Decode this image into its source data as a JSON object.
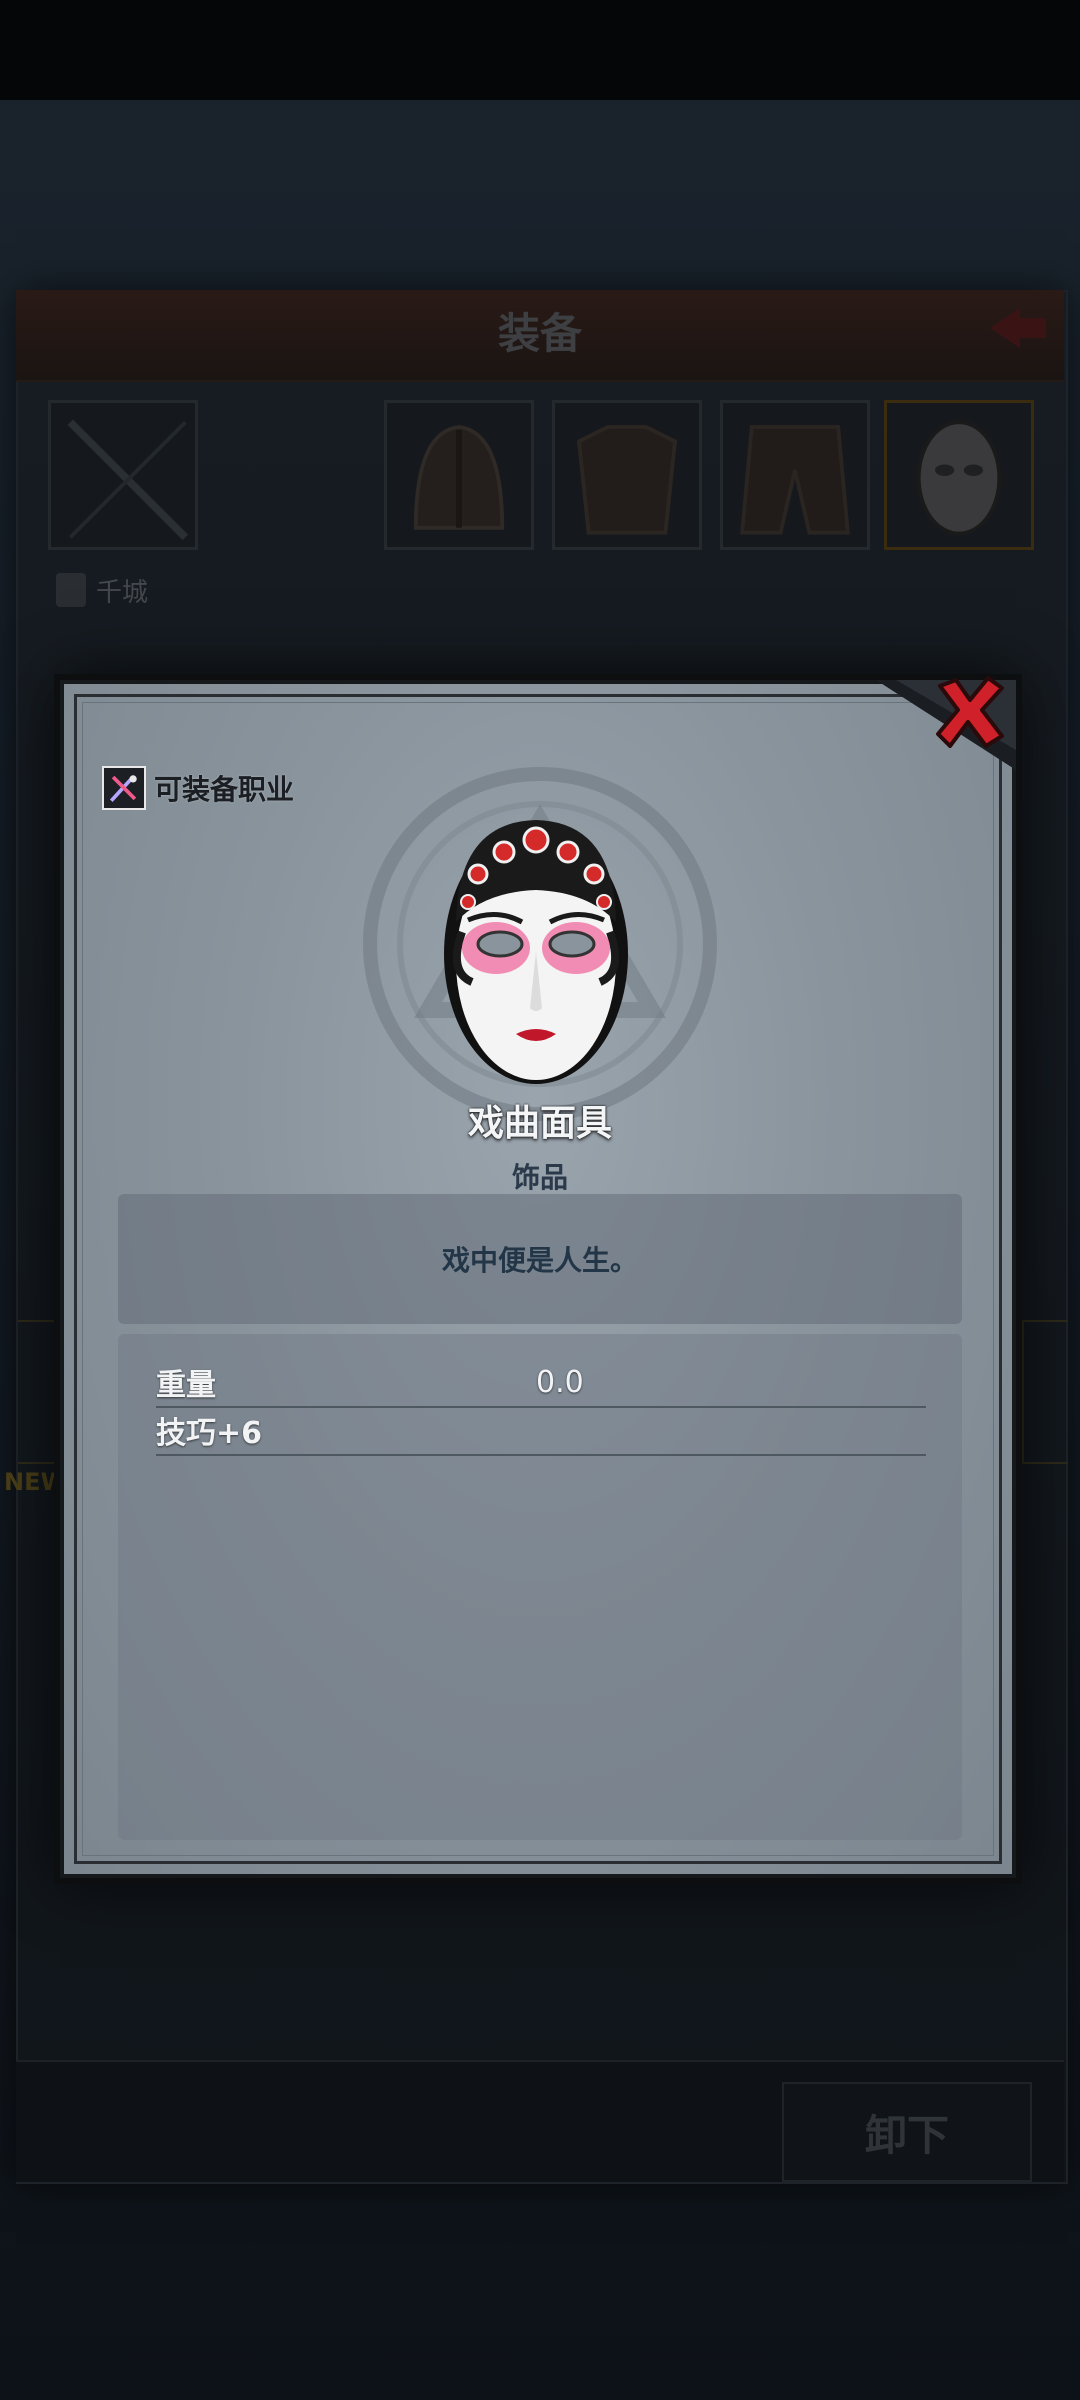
{
  "background": {
    "title": "装备",
    "city_label": "千城",
    "side_label": "NEW",
    "unequip_button": "卸下",
    "slots": [
      "weapon-slot",
      "empty-slot",
      "helmet-slot",
      "armor-slot",
      "pants-slot",
      "mask-slot"
    ]
  },
  "dialog": {
    "class_label": "可装备职业",
    "item_name": "戏曲面具",
    "item_type": "饰品",
    "description": "戏中便是人生。",
    "stats": [
      {
        "label": "重量",
        "value": "0.0"
      },
      {
        "label": "技巧+6",
        "value": ""
      }
    ]
  },
  "colors": {
    "dialog_bg": "#8a949d",
    "close_red": "#d0202a",
    "item_type_blue": "#2a3a4a"
  },
  "icons": {
    "close": "close-icon",
    "class": "class-icon",
    "item": "opera-mask-icon",
    "back": "back-arrow-icon"
  }
}
